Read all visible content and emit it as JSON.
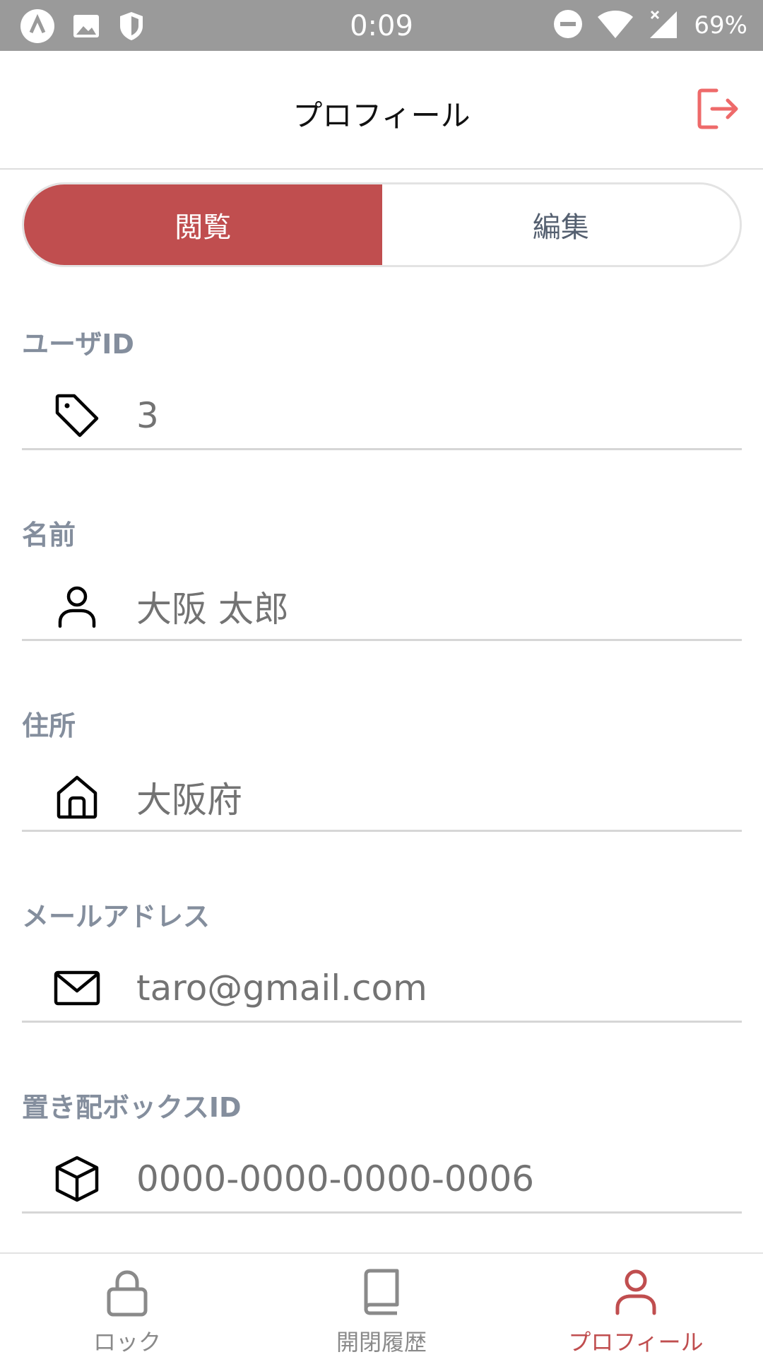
{
  "status_bar": {
    "time": "0:09",
    "battery": "69%"
  },
  "header": {
    "title": "プロフィール"
  },
  "segment": {
    "view_label": "閲覧",
    "edit_label": "編集"
  },
  "fields": [
    {
      "label": "ユーザID",
      "value": "3",
      "icon": "tag-icon"
    },
    {
      "label": "名前",
      "value": "大阪 太郎",
      "icon": "user-icon"
    },
    {
      "label": "住所",
      "value": "大阪府",
      "icon": "home-icon"
    },
    {
      "label": "メールアドレス",
      "value": "taro@gmail.com",
      "icon": "mail-icon"
    },
    {
      "label": "置き配ボックスID",
      "value": "0000-0000-0000-0006",
      "icon": "box-icon"
    }
  ],
  "tabs": [
    {
      "label": "ロック",
      "icon": "lock-icon",
      "active": false
    },
    {
      "label": "開閉履歴",
      "icon": "book-icon",
      "active": false
    },
    {
      "label": "プロフィール",
      "icon": "user-icon",
      "active": true
    }
  ],
  "colors": {
    "accent": "#c04e4f",
    "logout": "#ee6a6a",
    "status_bar": "#9a9a9a",
    "label": "#848e9d"
  }
}
